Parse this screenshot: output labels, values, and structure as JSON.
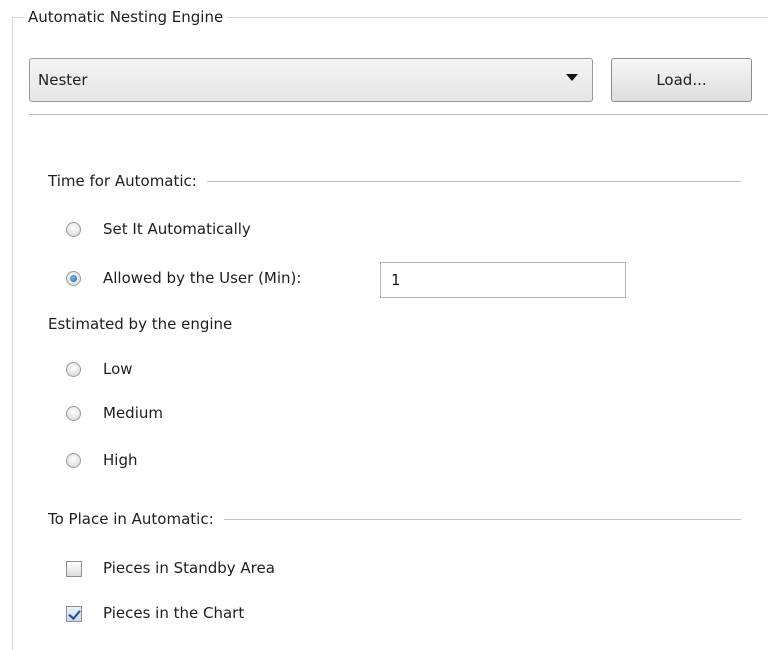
{
  "group": {
    "title": "Automatic Nesting Engine"
  },
  "engine": {
    "selected": "Nester",
    "load_label": "Load..."
  },
  "time": {
    "section_label": "Time for Automatic:",
    "options": [
      {
        "label": "Set It Automatically",
        "checked": false
      },
      {
        "label": "Allowed by the User (Min):",
        "checked": true
      }
    ],
    "minutes_value": "1",
    "estimated_label": "Estimated by the engine",
    "levels": [
      {
        "label": "Low",
        "checked": false
      },
      {
        "label": "Medium",
        "checked": false
      },
      {
        "label": "High",
        "checked": false
      }
    ]
  },
  "place": {
    "section_label": "To Place in Automatic:",
    "options": [
      {
        "label": "Pieces in Standby Area",
        "checked": false
      },
      {
        "label": "Pieces in the Chart",
        "checked": true
      }
    ]
  }
}
